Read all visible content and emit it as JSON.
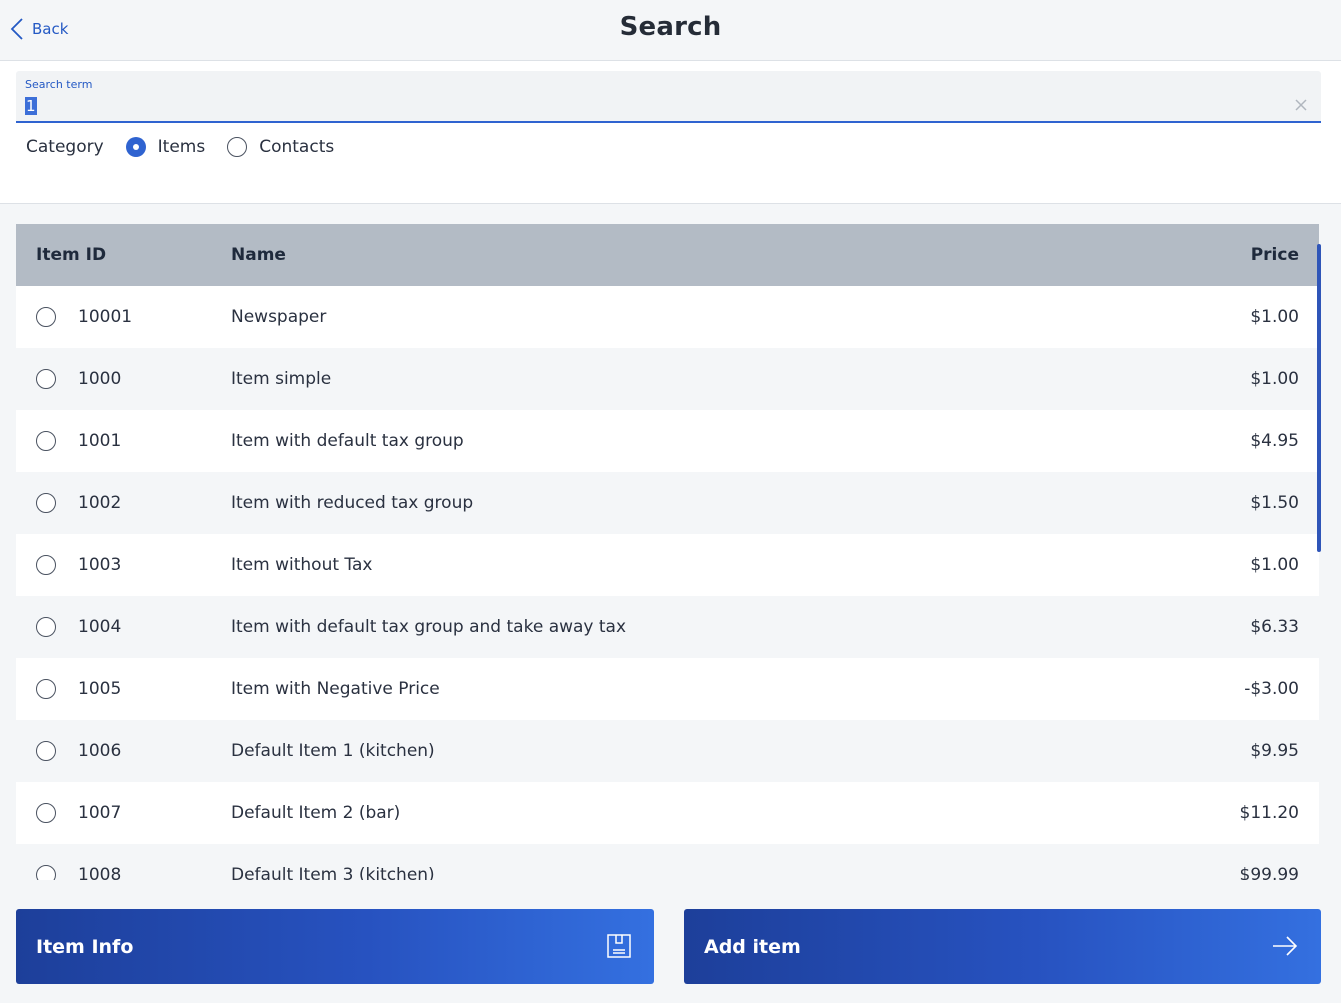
{
  "header": {
    "back_label": "Back",
    "title": "Search"
  },
  "search": {
    "label": "Search term",
    "value": "1",
    "placeholder": ""
  },
  "category": {
    "label": "Category",
    "options": [
      {
        "label": "Items",
        "selected": true
      },
      {
        "label": "Contacts",
        "selected": false
      }
    ]
  },
  "table": {
    "columns": [
      "Item ID",
      "Name",
      "Price"
    ],
    "rows": [
      {
        "id": "10001",
        "name": "Newspaper",
        "price": "$1.00"
      },
      {
        "id": "1000",
        "name": "Item simple",
        "price": "$1.00"
      },
      {
        "id": "1001",
        "name": "Item with default tax group",
        "price": "$4.95"
      },
      {
        "id": "1002",
        "name": "Item with reduced tax group",
        "price": "$1.50"
      },
      {
        "id": "1003",
        "name": "Item without Tax",
        "price": "$1.00"
      },
      {
        "id": "1004",
        "name": "Item with default tax group and take away tax",
        "price": "$6.33"
      },
      {
        "id": "1005",
        "name": "Item with Negative Price",
        "price": "-$3.00"
      },
      {
        "id": "1006",
        "name": "Default Item 1 (kitchen)",
        "price": "$9.95"
      },
      {
        "id": "1007",
        "name": "Default Item 2 (bar)",
        "price": "$11.20"
      },
      {
        "id": "1008",
        "name": "Default Item 3 (kitchen)",
        "price": "$99.99"
      }
    ]
  },
  "actions": {
    "item_info_label": "Item Info",
    "add_item_label": "Add item"
  },
  "icons": {
    "back": "chevron-left-icon",
    "clear": "close-icon",
    "item_info": "document-icon",
    "add_item": "arrow-right-icon"
  },
  "colors": {
    "accent": "#2f63d0",
    "header_row": "#b3bbc5"
  }
}
